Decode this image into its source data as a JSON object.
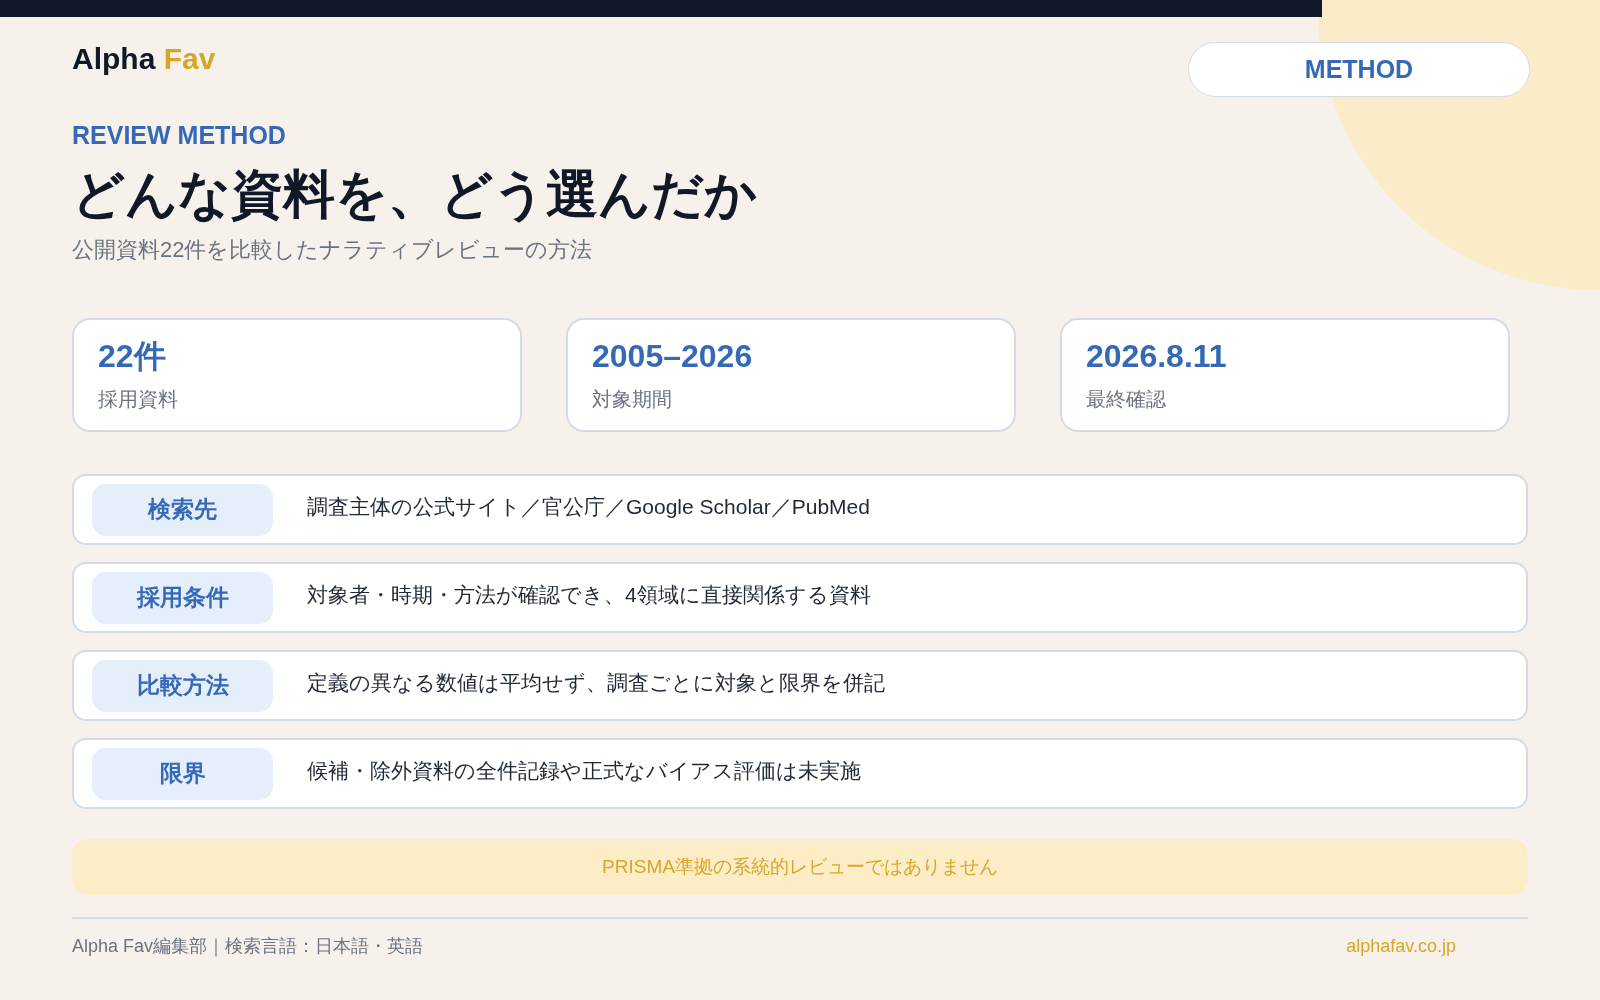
{
  "brand": {
    "first": "Alpha",
    "second": "Fav"
  },
  "badge": "METHOD",
  "eyebrow": "REVIEW METHOD",
  "title": "どんな資料を、どう選んだか",
  "subtitle": "公開資料22件を比較したナラティブレビューの方法",
  "stats": [
    {
      "value": "22件",
      "label": "採用資料"
    },
    {
      "value": "2005–2026",
      "label": "対象期間"
    },
    {
      "value": "2026.8.11",
      "label": "最終確認"
    }
  ],
  "rows": [
    {
      "label": "検索先",
      "text": "調査主体の公式サイト／官公庁／Google Scholar／PubMed"
    },
    {
      "label": "採用条件",
      "text": "対象者・時期・方法が確認でき、4領域に直接関係する資料"
    },
    {
      "label": "比較方法",
      "text": "定義の異なる数値は平均せず、調査ごとに対象と限界を併記"
    },
    {
      "label": "限界",
      "text": "候補・除外資料の全件記録や正式なバイアス評価は未実施"
    }
  ],
  "note": "PRISMA準拠の系統的レビューではありません",
  "footer": {
    "credit": "Alpha Fav編集部｜検索言語：日本語・英語",
    "site": "alphafav.co.jp"
  }
}
